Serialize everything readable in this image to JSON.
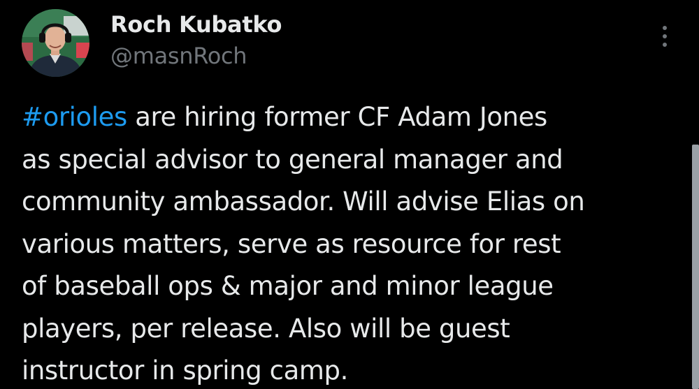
{
  "author": {
    "display_name": "Roch Kubatko",
    "handle": "@masnRoch",
    "avatar_icon": "profile-photo"
  },
  "menu": {
    "icon": "more-vertical-icon"
  },
  "tweet": {
    "hashtag": "#orioles",
    "lines": [
      " are hiring former CF Adam Jones",
      "as special advisor to general manager and",
      "community ambassador. Will advise Elias on",
      "various matters, serve as resource for rest",
      "of baseball ops & major and minor league",
      "players, per release. Also will be guest",
      "instructor in spring camp."
    ]
  },
  "colors": {
    "background": "#000000",
    "text": "#e7e9ea",
    "secondary": "#71767b",
    "link": "#1d9bf0"
  }
}
